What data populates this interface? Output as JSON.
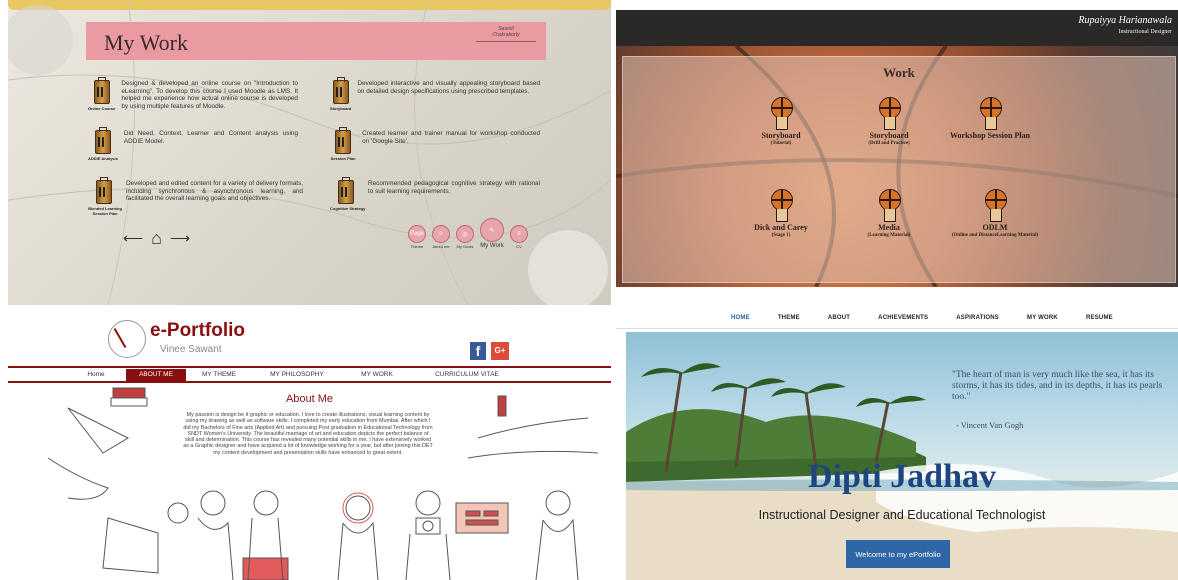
{
  "q1": {
    "title": "My Work",
    "author_line1": "Saumil",
    "author_line2": "Chakraborty",
    "items": [
      {
        "label": "Online Course",
        "desc": "Designed & developed an online course on \"Introduction to eLearning\". To develop this course I used Moodle as LMS. It helped me experience how actual online course is developed by using multiple features of Moodle."
      },
      {
        "label": "Storyboard",
        "desc": "Developed interactive and visually appealing storyboard based on detailed design specifications using prescribed templates."
      },
      {
        "label": "ADDIE Analysis",
        "desc": "Did Need, Context, Learner and Content analysis using ADDIE Model."
      },
      {
        "label": "Session Plan",
        "desc": "Created learner and trainer manual for workshop conducted on 'Google Site'."
      },
      {
        "label": "Blended Learning Session Plan",
        "desc": "Developed and edited content for a variety of delivery formats, including synchronous & asynchronous learning, and facilitated the overall learning goals and objectives."
      },
      {
        "label": "Cognitive Strategy",
        "desc": "Recommended pedagogical cognitive strategy with rational to suit learning requirements."
      }
    ],
    "nav_circles": [
      {
        "label": "Theme",
        "glyph": "Page"
      },
      {
        "label": "About me",
        "glyph": "☺"
      },
      {
        "label": "My Goals",
        "glyph": "◎"
      },
      {
        "label": "My Work",
        "glyph": "✎"
      },
      {
        "label": "CV",
        "glyph": "≡"
      }
    ]
  },
  "q2": {
    "name": "Rupaiyya Harianawala",
    "role": "Instructional Designer",
    "title": "Work",
    "items": [
      {
        "t1": "Storyboard",
        "t2": "(Tutorial)"
      },
      {
        "t1": "Storyboard",
        "t2": "(Drill and Practice)"
      },
      {
        "t1": "Workshop Session Plan",
        "t2": ""
      },
      {
        "t1": "Dick and Carey",
        "t2": "(Stage 1)"
      },
      {
        "t1": "Media",
        "t2": "(Learning Material)"
      },
      {
        "t1": "ODLM",
        "t2": "(Online and DistanceLearning Material)"
      }
    ]
  },
  "q3": {
    "brand": "e-Portfolio",
    "subtitle": "Vinee Sawant",
    "fb": "f",
    "gplus": "G+",
    "nav": [
      "Home",
      "ABOUT ME",
      "MY THEME",
      "MY PHILOSOPHY",
      "MY WORK",
      "CURRICULUM VITAE"
    ],
    "heading": "About Me",
    "paragraph": "My passion is design be it graphic or education. I love to create illustrations, visual learning content by using my drawing as well as software skills. I completed my early education from Mumbai. After which I did my Bachelors of Fine arts (Applied Art) and pursuing Post graduation in Educational Technology from SNDT Women's University. The beautiful marriage of art and education depicts the perfect balance of skill and determination. This course has revealed many potential skills in me. I have extensively worked as a Graphic designer and have acquired a lot of knowledge working for a year, but after joining this DET my content development and presentation skills have enhanced to great extent."
  },
  "q4": {
    "nav": [
      "HOME",
      "THEME",
      "ABOUT",
      "ACHIEVEMENTS",
      "ASPIRATIONS",
      "MY WORK",
      "RESUME"
    ],
    "quote": "\"The heart of man is very much like the sea, it has its storms, it has its tides, and in its depths, it has its pearls too.\"",
    "quote_author": "- Vincent Van Gogh",
    "name": "Dipti Jadhav",
    "tagline": "Instructional Designer and Educational Technologist",
    "button": "Welcome to my ePortfolio"
  }
}
